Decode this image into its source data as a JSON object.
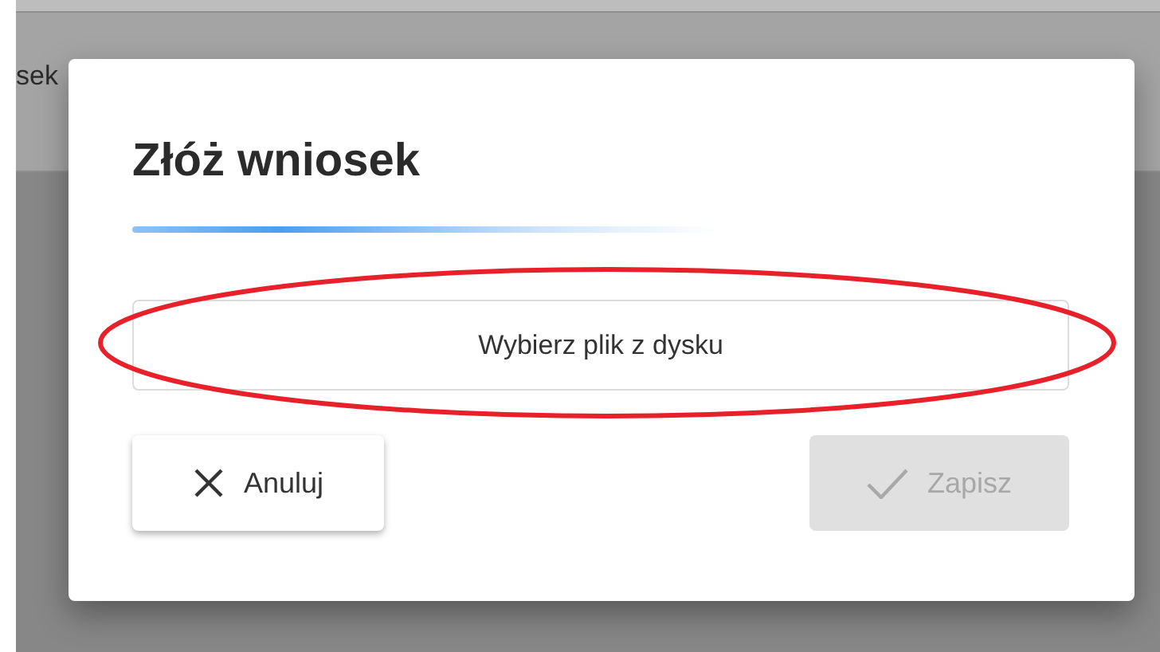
{
  "background": {
    "header_text": "sek"
  },
  "dialog": {
    "title": "Złóż wniosek",
    "file_button": {
      "label": "Wybierz plik z dysku"
    },
    "buttons": [
      {
        "kind": "cancel",
        "label": "Anuluj",
        "disabled": false
      },
      {
        "kind": "save",
        "label": "Zapisz",
        "disabled": true
      }
    ]
  }
}
